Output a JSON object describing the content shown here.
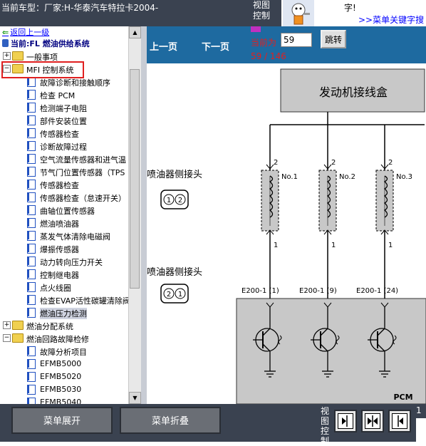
{
  "topbar": {
    "car_model": "当前车型：厂家:H-华泰汽车特拉卡2004-",
    "view_control": "视图控制",
    "search_text1": "字!",
    "search_link": ">>菜单关键字搜"
  },
  "tree": {
    "back_link": "返回上一级",
    "current_path": "当前:FL 燃油供给系统",
    "items": [
      {
        "label": "一般事项",
        "type": "folder",
        "pm": "+",
        "indent": 0
      },
      {
        "label": "MFI 控制系统",
        "type": "folder",
        "pm": "−",
        "indent": 0
      },
      {
        "label": "故障诊断和接触顺序",
        "type": "doc",
        "indent": 1
      },
      {
        "label": "检查 PCM",
        "type": "doc",
        "indent": 1
      },
      {
        "label": "检测端子电阻",
        "type": "doc",
        "indent": 1
      },
      {
        "label": "部件安装位置",
        "type": "doc",
        "indent": 1
      },
      {
        "label": "传感器检查",
        "type": "doc",
        "indent": 1
      },
      {
        "label": "诊断故障过程",
        "type": "doc",
        "indent": 1
      },
      {
        "label": "空气流量传感器和进气温",
        "type": "doc",
        "indent": 1
      },
      {
        "label": "节气门位置传感器（TPS",
        "type": "doc",
        "indent": 1
      },
      {
        "label": "传感器检查",
        "type": "doc",
        "indent": 1
      },
      {
        "label": "传感器检查（怠速开关）",
        "type": "doc",
        "indent": 1
      },
      {
        "label": "曲轴位置传感器",
        "type": "doc",
        "indent": 1
      },
      {
        "label": "燃油喷油器",
        "type": "doc",
        "indent": 1
      },
      {
        "label": "蒸发气体清除电磁阀",
        "type": "doc",
        "indent": 1
      },
      {
        "label": "爆振传感器",
        "type": "doc",
        "indent": 1
      },
      {
        "label": "动力转向压力开关",
        "type": "doc",
        "indent": 1
      },
      {
        "label": "控制继电器",
        "type": "doc",
        "indent": 1
      },
      {
        "label": "点火线圈",
        "type": "doc",
        "indent": 1
      },
      {
        "label": "检查EVAP活性碳罐清除阀",
        "type": "doc",
        "indent": 1
      },
      {
        "label": "燃油压力检测",
        "type": "doc",
        "indent": 1,
        "selected": true
      },
      {
        "label": "燃油分配系统",
        "type": "folder",
        "pm": "+",
        "indent": 0
      },
      {
        "label": "燃油回路故障检修",
        "type": "folder",
        "pm": "−",
        "indent": 0
      },
      {
        "label": "故障分析项目",
        "type": "doc",
        "indent": 1
      },
      {
        "label": "EFMB5000",
        "type": "doc",
        "indent": 1
      },
      {
        "label": "EFMB5020",
        "type": "doc",
        "indent": 1
      },
      {
        "label": "EFMB5030",
        "type": "doc",
        "indent": 1
      },
      {
        "label": "EFMB5040",
        "type": "doc",
        "indent": 1
      }
    ]
  },
  "toolbar": {
    "prev": "上一页",
    "next": "下一页",
    "current_label": "当前为",
    "page_value": "59",
    "jump": "跳转",
    "page_count": "59 / 146"
  },
  "diagram": {
    "junction_box": "发动机接线盒",
    "injector_connector_1": "喷油器侧接头",
    "injector_connector_2": "喷油器侧接头",
    "connector_pins_1": [
      "1",
      "2"
    ],
    "connector_pins_2": [
      "2",
      "1"
    ],
    "injectors": [
      {
        "label": "No.1",
        "top_pin": "2",
        "bottom_pin": "1",
        "pcm_pin": "E200-1 (1)"
      },
      {
        "label": "No.2",
        "top_pin": "2",
        "bottom_pin": "1",
        "pcm_pin": "E200-1 (9)"
      },
      {
        "label": "No.3",
        "top_pin": "2",
        "bottom_pin": "1",
        "pcm_pin": "E200-1 (24)"
      }
    ],
    "pcm_label": "PCM"
  },
  "bottombar": {
    "expand": "菜单展开",
    "collapse": "菜单折叠",
    "view_control": "视图控制",
    "stray": "1"
  },
  "colors": {
    "toolbar_blue": "#1e6aa0",
    "chrome_dark": "#3a4250",
    "page_red": "#e02020"
  }
}
